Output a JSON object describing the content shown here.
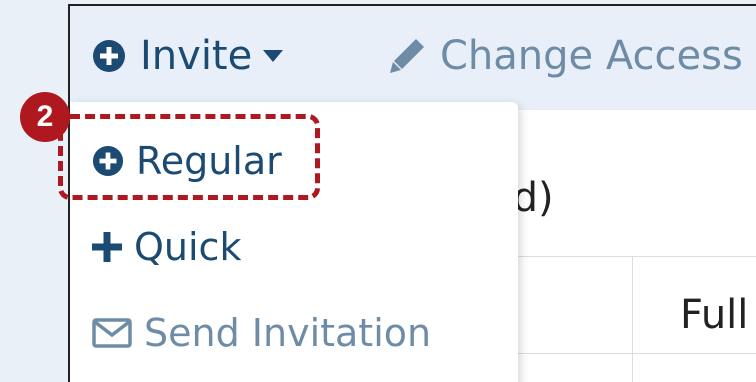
{
  "toolbar": {
    "invite_label": "Invite",
    "change_access_label": "Change Access"
  },
  "subheader": {
    "partial_text": "ed)"
  },
  "table": {
    "column_partial": "Full"
  },
  "menu": {
    "items": [
      {
        "label": "Regular",
        "icon": "circle-plus-icon"
      },
      {
        "label": "Quick",
        "icon": "plus-icon"
      },
      {
        "label": "Send Invitation",
        "icon": "envelope-icon"
      }
    ]
  },
  "annotation": {
    "step_number": "2",
    "color": "#b0181f"
  },
  "colors": {
    "primary_text": "#1b4a73",
    "muted_text": "#6f8ca6",
    "toolbar_bg": "#e8eff8"
  }
}
